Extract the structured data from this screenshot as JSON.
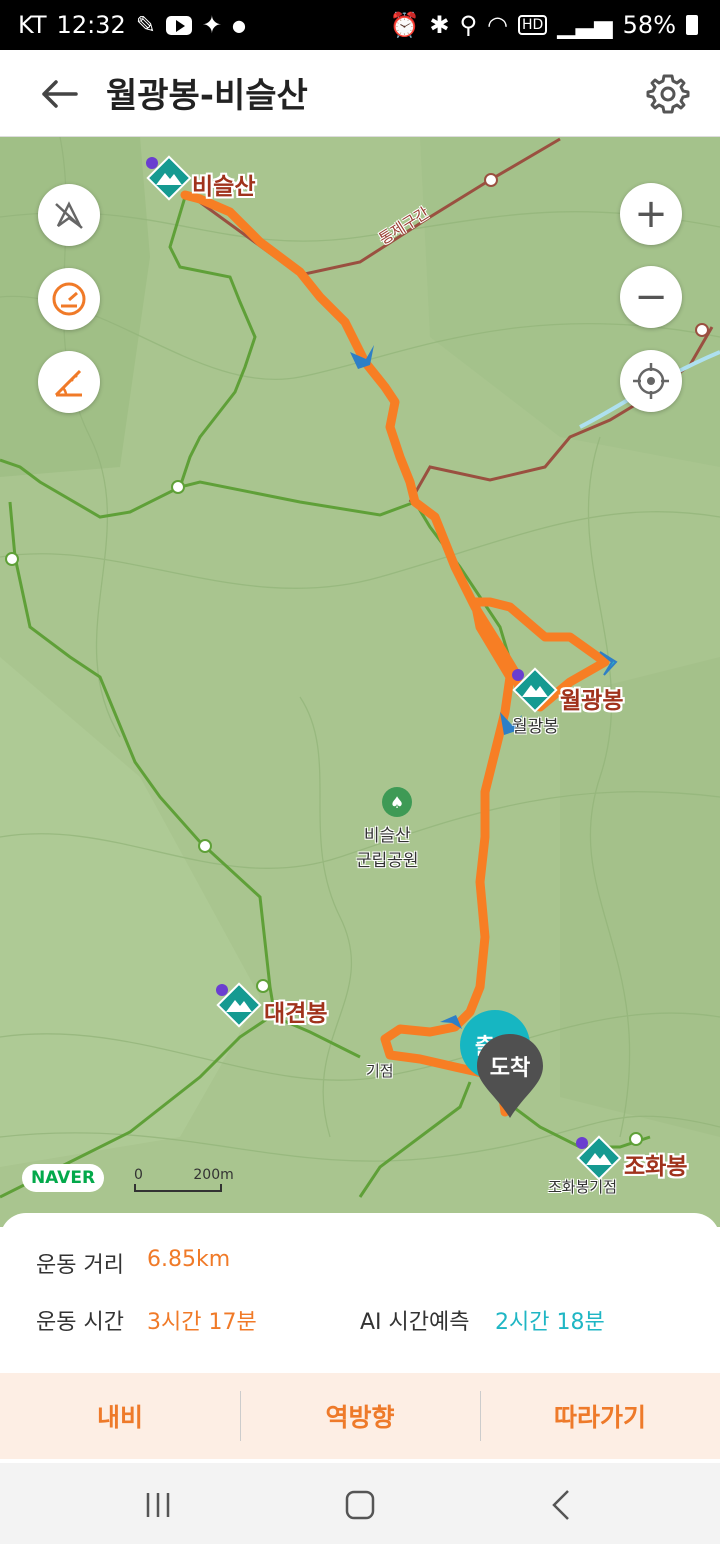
{
  "status_bar": {
    "carrier": "KT",
    "time": "12:32",
    "hd": "HD",
    "battery": "58%"
  },
  "header": {
    "title": "월광봉-비슬산"
  },
  "map": {
    "peaks": {
      "biseulsan": "비슬산",
      "wolgwangbong": "월광봉",
      "daegyeonbong": "대견봉",
      "johwabong": "조화봉"
    },
    "labels": {
      "park": "비슬산\n군립공원",
      "wolgwangbong_small": "월광봉",
      "johwabong_base": "조화봉기점",
      "gijeom": "기점",
      "restricted": "통제구간"
    },
    "arrival_marker": "도착",
    "start_marker": "출",
    "brand": "NAVER",
    "scale_zero": "0",
    "scale_value": "200m",
    "colors": {
      "route": "#f77e24",
      "trail": "#5fa038",
      "restricted": "#9a5040",
      "accent": "#16b6c2"
    }
  },
  "controls": {
    "zoom_in": "+",
    "zoom_out": "−"
  },
  "stats": {
    "distance_label": "운동 거리",
    "distance_value": "6.85km",
    "time_label": "운동 시간",
    "time_value": "3시간 17분",
    "ai_label": "AI 시간예측",
    "ai_value": "2시간 18분"
  },
  "actions": {
    "navi": "내비",
    "reverse": "역방향",
    "follow": "따라가기"
  }
}
